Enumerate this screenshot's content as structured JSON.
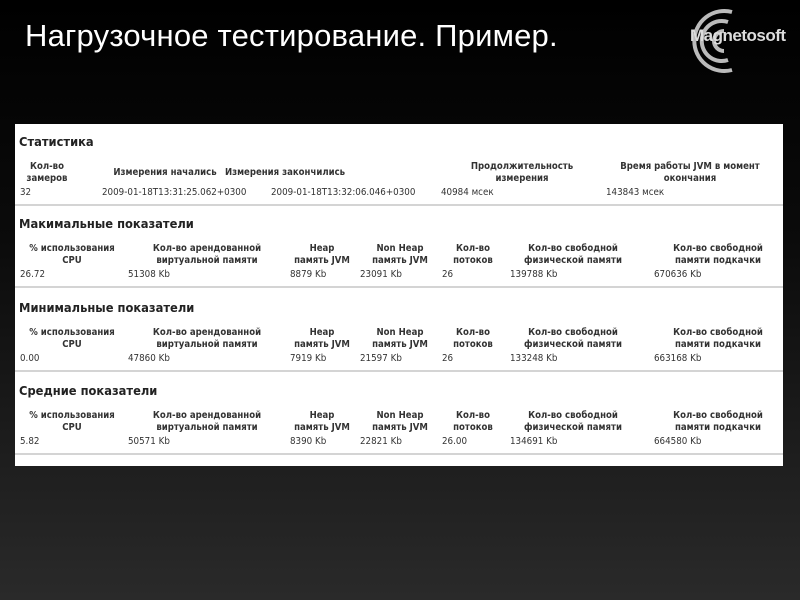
{
  "slide": {
    "title": "Нагрузочное тестирование. Пример.",
    "logo_text": "Magnetosoft"
  },
  "stats": {
    "heading": "Статистика",
    "headers": [
      "Кол-во\nзамеров",
      "Измерения начались",
      "Измерения закончились",
      "Продолжительность\nизмерения",
      "Время работы JVM в момент\nокончания"
    ],
    "values": [
      "32",
      "2009-01-18T13:31:25.062+0300",
      "2009-01-18T13:32:06.046+0300",
      "40984 мсек",
      "143843 мсек"
    ]
  },
  "metric_headers": [
    "% использования\nCPU",
    "Кол-во арендованной\nвиртуальной памяти",
    "Heap\nпамять JVM",
    "Non Heap\nпамять JVM",
    "Кол-во\nпотоков",
    "Кол-во свободной\nфизической памяти",
    "Кол-во свободной\nпамяти подкачки"
  ],
  "sections": [
    {
      "heading": "Макимальные показатели",
      "values": [
        "26.72",
        "51308 Kb",
        "8879 Kb",
        "23091 Kb",
        "26",
        "139788 Kb",
        "670636 Kb"
      ]
    },
    {
      "heading": "Минимальные показатели",
      "values": [
        "0.00",
        "47860 Kb",
        "7919 Kb",
        "21597 Kb",
        "26",
        "133248 Kb",
        "663168 Kb"
      ]
    },
    {
      "heading": "Средние показатели",
      "values": [
        "5.82",
        "50571 Kb",
        "8390 Kb",
        "22821 Kb",
        "26.00",
        "134691 Kb",
        "664580 Kb"
      ]
    }
  ]
}
